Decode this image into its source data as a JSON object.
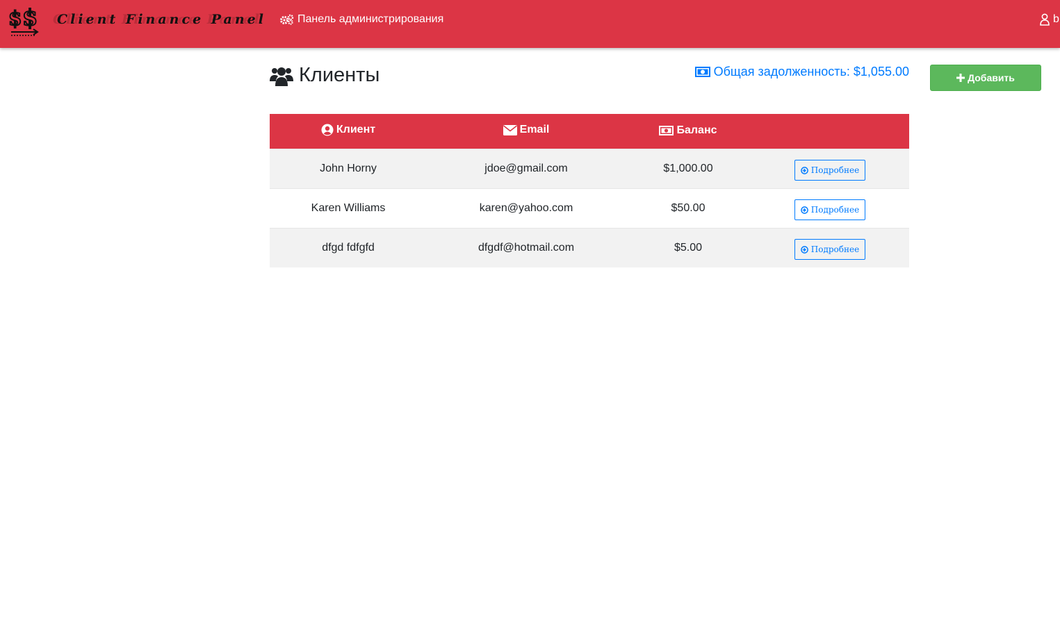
{
  "navbar": {
    "brand": "Client Finance Panel",
    "admin_link": "Панель администрирования",
    "user_label": "b"
  },
  "page": {
    "title": "Клиенты",
    "total_debt_label": "Общая задолженность: $1,055.00",
    "add_button": "Добавить"
  },
  "table": {
    "headers": {
      "client": "Клиент",
      "email": "Email",
      "balance": "Баланс"
    },
    "rows": [
      {
        "name": "John Horny",
        "email": "jdoe@gmail.com",
        "balance": "$1,000.00",
        "action": "Подробнее"
      },
      {
        "name": "Karen Williams",
        "email": "karen@yahoo.com",
        "balance": "$50.00",
        "action": "Подробнее"
      },
      {
        "name": "dfgd fdfgfd",
        "email": "dfgdf@hotmail.com",
        "balance": "$5.00",
        "action": "Подробнее"
      }
    ]
  },
  "colors": {
    "primary_red": "#dc3545",
    "link_blue": "#007bff",
    "success_green": "#5cb85c"
  },
  "icons": {
    "logo": "dollar-arrow-logo",
    "admin": "gears-icon",
    "user": "user-icon",
    "title": "users-icon",
    "debt": "money-bill-icon",
    "add": "plus-icon",
    "client_header": "user-circle-icon",
    "email_header": "envelope-icon",
    "balance_header": "money-bill-icon",
    "details": "arrow-circle-right-icon"
  }
}
